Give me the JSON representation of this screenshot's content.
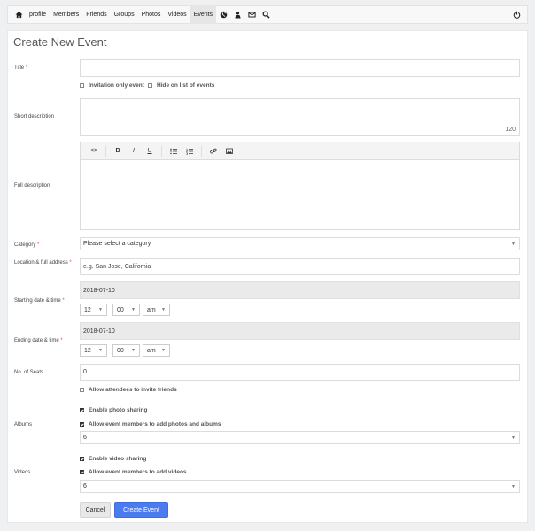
{
  "nav": {
    "items": [
      "profile",
      "Members",
      "Friends",
      "Groups",
      "Photos",
      "Videos",
      "Events"
    ],
    "icons": [
      "home-icon",
      "globe-icon",
      "user-icon",
      "mail-icon",
      "search-icon",
      "power-icon"
    ]
  },
  "page": {
    "title": "Create New Event"
  },
  "form": {
    "title_label": "Title",
    "invitation_only": "Invitation only event",
    "hide_on_list": "Hide on list of events",
    "short_desc_label": "Short description",
    "short_desc_counter": "120",
    "full_desc_label": "Full description",
    "category_label": "Category",
    "category_value": "Please select a category",
    "location_label": "Location & full address",
    "location_placeholder": "e.g. San Jose, California",
    "start_label": "Starting date & time",
    "start_date": "2018-07-10",
    "start_hour": "12",
    "start_min": "00",
    "start_ampm": "am",
    "end_label": "Ending date & time",
    "end_date": "2018-07-10",
    "end_hour": "12",
    "end_min": "00",
    "end_ampm": "am",
    "seats_label": "No. of Seats",
    "seats_value": "0",
    "allow_invite": "Allow attendees to invite friends",
    "albums_label": "Albums",
    "enable_photo": "Enable photo sharing",
    "allow_photos": "Allow event members to add photos and albums",
    "albums_value": "6",
    "videos_label": "Videos",
    "enable_video": "Enable video sharing",
    "allow_videos": "Allow event members to add videos",
    "videos_value": "6",
    "cancel": "Cancel",
    "create": "Create Event",
    "required_mark": "*"
  },
  "editor": {
    "buttons": [
      "<>",
      "B",
      "I",
      "U"
    ]
  },
  "colors": {
    "accent": "#4c7bf0",
    "required": "#d9534f"
  }
}
